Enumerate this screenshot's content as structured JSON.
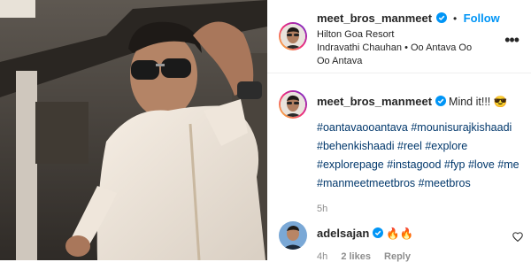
{
  "post": {
    "username": "meet_bros_manmeet",
    "follow_label": "Follow",
    "separator": "•",
    "location": "Hilton Goa Resort",
    "audio": "Indravathi Chauhan • Oo Antava Oo Oo Antava",
    "more_label": "•••"
  },
  "caption": {
    "username": "meet_bros_manmeet",
    "text": "Mind it!!! 😎",
    "hashtags": "#oantavaooantava #mounisurajkishaadi #behenkishaadi #reel #explore #explorepage #instagood #fyp #love #me #manmeetmeetbros #meetbros",
    "time": "5h"
  },
  "comment": {
    "username": "adelsajan",
    "text": "🔥🔥",
    "time": "4h",
    "likes": "2 likes",
    "reply": "Reply"
  },
  "colors": {
    "accent": "#0095f6",
    "verified": "#0095f6",
    "hashtag": "#00376b",
    "meta": "#8e8e8e"
  }
}
